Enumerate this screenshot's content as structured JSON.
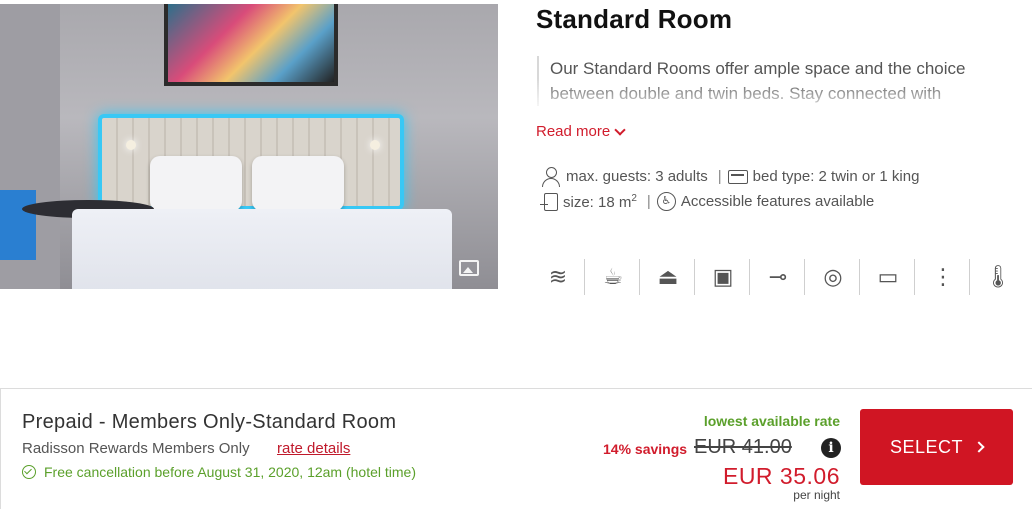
{
  "room": {
    "title": "Standard Room",
    "description": "Our Standard Rooms offer ample space and the choice between double and twin beds. Stay connected with",
    "read_more": "Read more",
    "guests": "max. guests: 3 adults",
    "bed_type": "bed type: 2 twin or 1 king",
    "size": "size: 18 m",
    "size_unit_sup": "2",
    "accessible": "Accessible features available",
    "amenities": [
      {
        "icon": "wifi-icon",
        "glyph": "≋"
      },
      {
        "icon": "kettle-icon",
        "glyph": "☕"
      },
      {
        "icon": "iron-icon",
        "glyph": "⏏"
      },
      {
        "icon": "safe-icon",
        "glyph": "▣"
      },
      {
        "icon": "hairdryer-icon",
        "glyph": "⊸"
      },
      {
        "icon": "mirror-icon",
        "glyph": "◎"
      },
      {
        "icon": "tv-icon",
        "glyph": "▭"
      },
      {
        "icon": "shower-icon",
        "glyph": "⋮"
      },
      {
        "icon": "thermometer-icon",
        "glyph": "🌡"
      }
    ]
  },
  "rate": {
    "name": "Prepaid - Members Only-Standard Room",
    "subtitle": "Radisson Rewards Members Only",
    "details_link": "rate details",
    "cancellation": "Free cancellation before August 31, 2020, 12am (hotel time)",
    "lowest_label": "lowest available rate",
    "savings": "14% savings",
    "old_price": "EUR 41.00",
    "info": "i",
    "price": "EUR 35.06",
    "per_night": "per night",
    "select_label": "SELECT"
  },
  "colors": {
    "brand_red": "#d01523",
    "savings_green": "#5ba02b",
    "price_red": "#d11c2c"
  }
}
